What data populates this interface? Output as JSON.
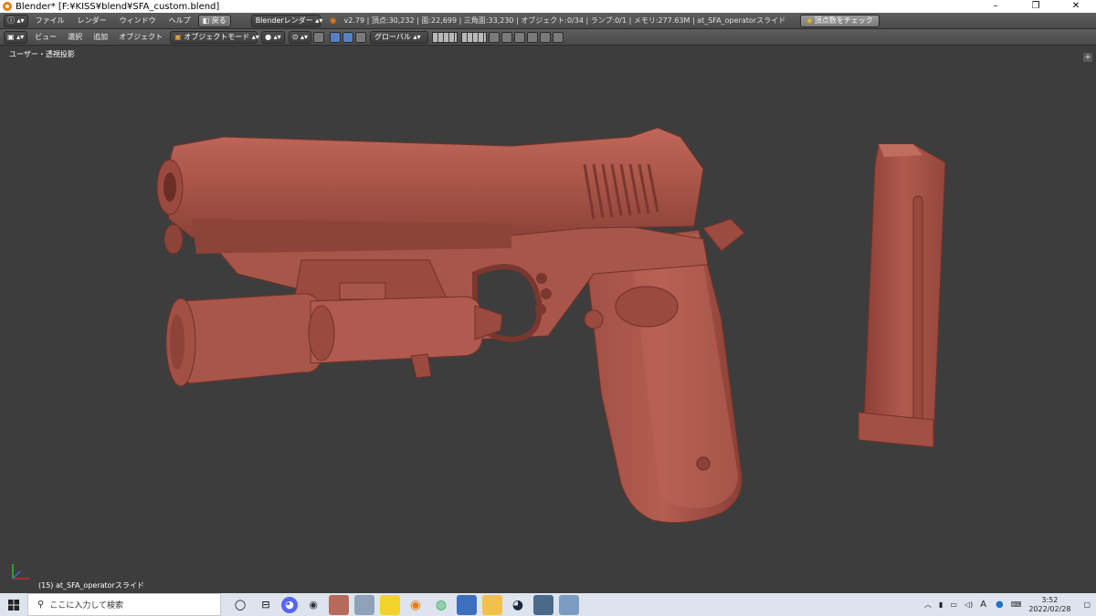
{
  "window": {
    "title": "Blender* [F:¥KISS¥blend¥SFA_custom.blend]",
    "controls": [
      "–",
      "❐",
      "✕"
    ]
  },
  "info_header": {
    "menus": [
      "ファイル",
      "レンダー",
      "ウィンドウ",
      "ヘルプ"
    ],
    "back_button": "戻る",
    "render_engine": "Blenderレンダー",
    "stats": "v2.79 | 頂点:30,232 | 面:22,699 | 三角面:33,230 | オブジェクト:0/34 | ランプ:0/1 | メモリ:277.63M | at_SFA_operatorスライド",
    "check_button": "頂点数をチェック"
  },
  "view_header": {
    "menus": [
      "ビュー",
      "選択",
      "追加",
      "オブジェクト"
    ],
    "mode": "オブジェクトモード",
    "orientation": "グローバル"
  },
  "viewport": {
    "view_label": "ユーザー・透視投影",
    "status": "(15) at_SFA_operatorスライド",
    "model_color": "#b15a4f",
    "background_color": "#3d3d3d"
  },
  "taskbar": {
    "search_placeholder": "ここに入力して検索",
    "time": "3:52",
    "date": "2022/02/28"
  }
}
